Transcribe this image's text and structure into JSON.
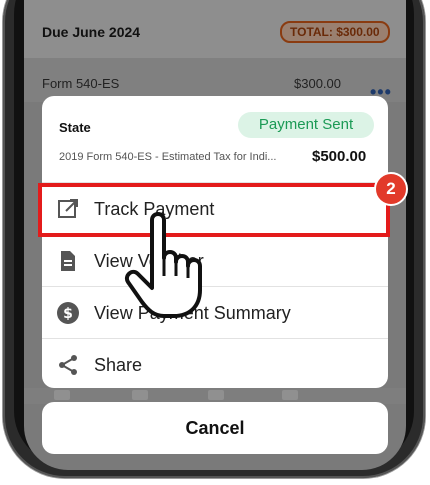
{
  "due_section": {
    "title": "Due June 2024",
    "total_badge": "TOTAL: $300.00",
    "form_name": "Form 540-ES",
    "form_amount": "$300.00",
    "more_icon": "ellipsis-icon"
  },
  "sheet": {
    "state_label": "State",
    "status": "Payment Sent",
    "description": "2019 Form 540-ES - Estimated Tax for Indi...",
    "amount": "$500.00",
    "items": [
      {
        "label": "Track Payment",
        "icon": "external-link-icon"
      },
      {
        "label": "View Voucher",
        "icon": "document-icon"
      },
      {
        "label": "View Payment Summary",
        "icon": "dollar-circle-icon"
      },
      {
        "label": "Share",
        "icon": "share-icon"
      }
    ]
  },
  "step_badge": "2",
  "cancel_label": "Cancel",
  "colors": {
    "status_green": "#1b9a55",
    "highlight_red": "#e31b1b",
    "badge_brown": "#8a3b10"
  }
}
